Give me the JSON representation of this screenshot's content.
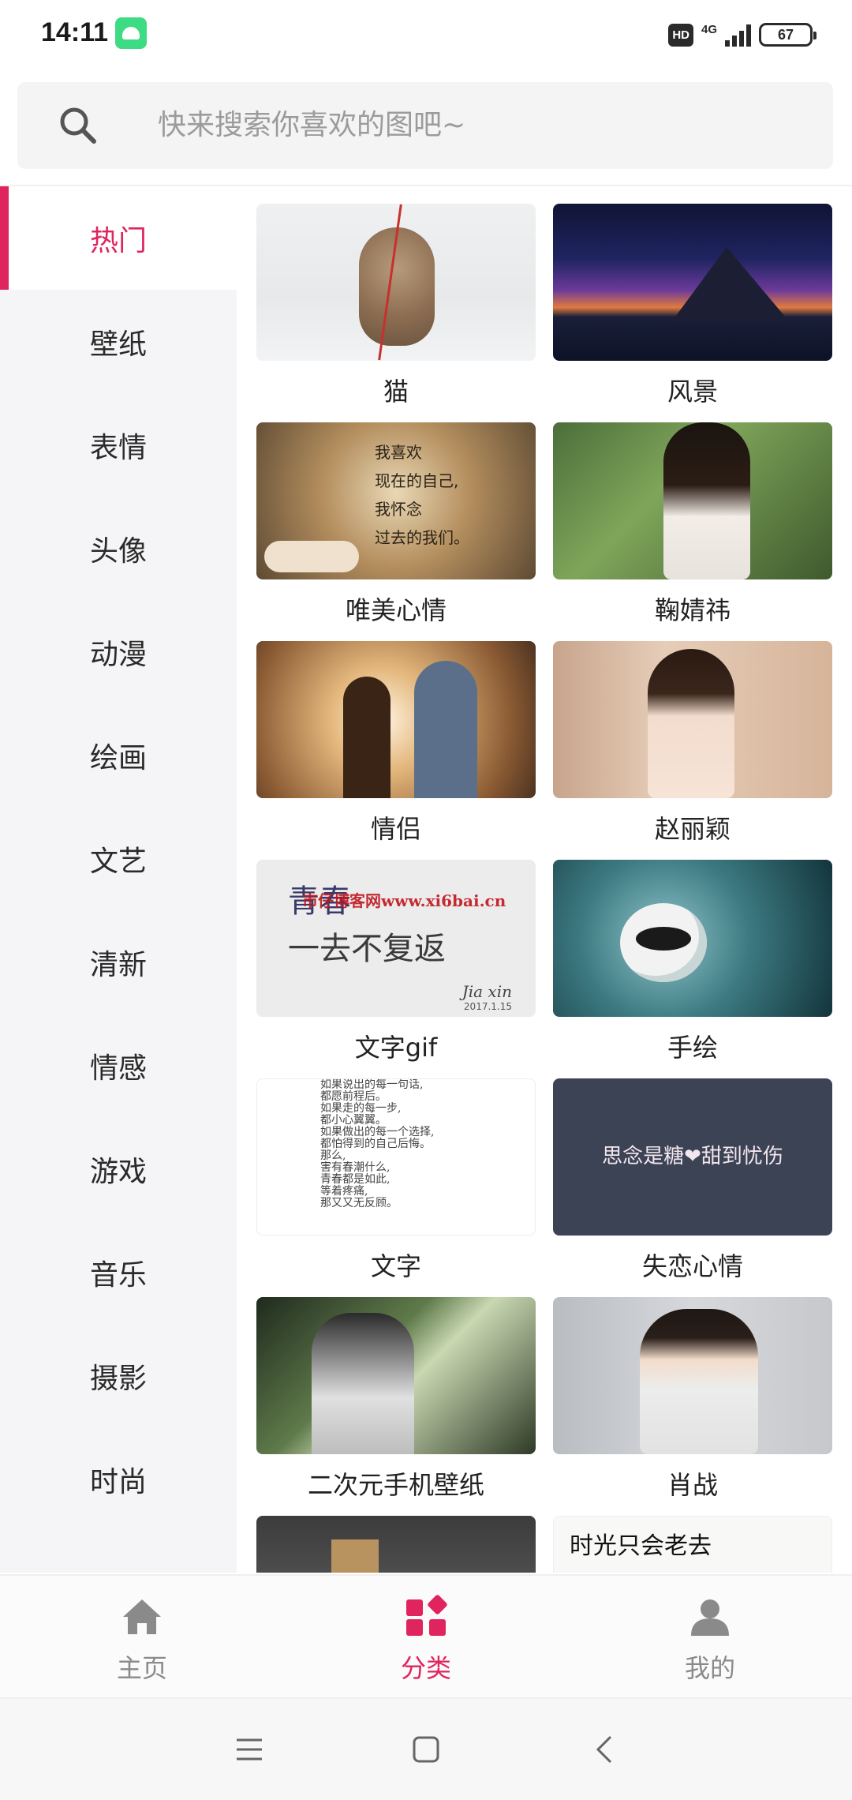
{
  "status_bar": {
    "time": "14:11",
    "hd_badge": "HD",
    "network": "4G",
    "battery": "67"
  },
  "search": {
    "placeholder": "快来搜索你喜欢的图吧~",
    "icon": "search-icon"
  },
  "sidebar": {
    "active_index": 0,
    "items": [
      {
        "label": "热门"
      },
      {
        "label": "壁纸"
      },
      {
        "label": "表情"
      },
      {
        "label": "头像"
      },
      {
        "label": "动漫"
      },
      {
        "label": "绘画"
      },
      {
        "label": "文艺"
      },
      {
        "label": "清新"
      },
      {
        "label": "情感"
      },
      {
        "label": "游戏"
      },
      {
        "label": "音乐"
      },
      {
        "label": "摄影"
      },
      {
        "label": "时尚"
      }
    ]
  },
  "grid": {
    "cards": [
      {
        "label": "猫"
      },
      {
        "label": "风景"
      },
      {
        "label": "唯美心情"
      },
      {
        "label": "鞠婧祎"
      },
      {
        "label": "情侣"
      },
      {
        "label": "赵丽颖"
      },
      {
        "label": "文字gif"
      },
      {
        "label": "手绘"
      },
      {
        "label": "文字"
      },
      {
        "label": "失恋心情"
      },
      {
        "label": "二次元手机壁纸"
      },
      {
        "label": "肖战"
      }
    ],
    "thumb_text": {
      "mood": "我喜欢\n现在的自己,\n我怀念\n过去的我们。",
      "textgif_line1": "青春",
      "textgif_line2": "一去不复返",
      "textgif_sign": "Jia xin",
      "textgif_date": "2017.1.15",
      "watermark": "市仔博客网www.xi6bai.cn",
      "words": "如果说出的每一句话,\n都愿前程后。\n如果走的每一步,\n都小心翼翼。\n如果做出的每一个选择,\n都怕得到的自己后悔。\n那么,\n害有春潮什么,\n青春都是如此,\n等着疼痛,\n那又又无反顾。",
      "heartbreak": "思念是糖❤甜到忧伤",
      "calligraphy": "时光只会老去"
    }
  },
  "bottom_nav": {
    "active_index": 1,
    "items": [
      {
        "label": "主页",
        "icon": "home-icon"
      },
      {
        "label": "分类",
        "icon": "category-icon"
      },
      {
        "label": "我的",
        "icon": "person-icon"
      }
    ]
  },
  "colors": {
    "accent": "#e0245e",
    "inactive": "#8a8a8a",
    "sidebar_bg": "#f5f5f7"
  }
}
